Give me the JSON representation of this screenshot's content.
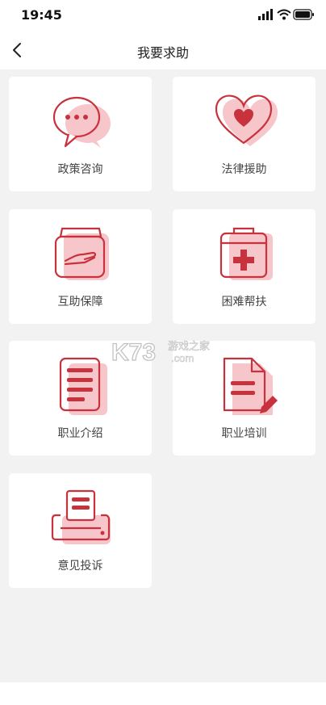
{
  "status_bar": {
    "time": "19:45"
  },
  "nav": {
    "title": "我要求助"
  },
  "cards": [
    {
      "label": "政策咨询"
    },
    {
      "label": "法律援助"
    },
    {
      "label": "互助保障"
    },
    {
      "label": "困难帮扶"
    },
    {
      "label": "职业介绍"
    },
    {
      "label": "职业培训"
    },
    {
      "label": "意见投诉"
    }
  ],
  "watermark": {
    "brand": "K73",
    "site_cn": "游戏之家",
    "site_en": ".com"
  },
  "colors": {
    "accent": "#c8323c",
    "accent_light": "#f6c6cb",
    "background": "#f2f2f2"
  }
}
